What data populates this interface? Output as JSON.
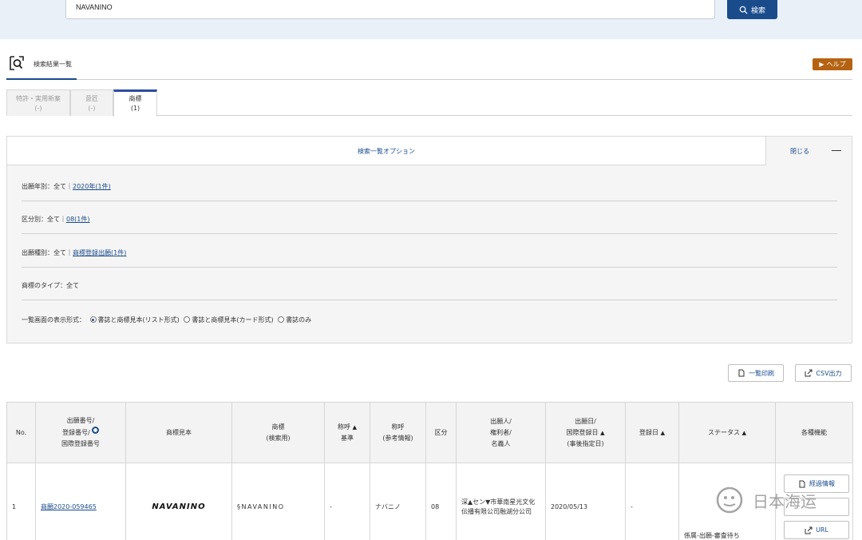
{
  "search": {
    "value": "NAVANINO",
    "button_label": "検索"
  },
  "results_header": {
    "title": "検索結果一覧",
    "help_label": "ヘルプ"
  },
  "tabs": [
    {
      "label": "特許・実用新案",
      "count": "(-)"
    },
    {
      "label": "意匠",
      "count": "(-)"
    },
    {
      "label": "商標",
      "count": "(1)"
    }
  ],
  "options": {
    "title": "検索一覧オプション",
    "close_label": "閉じる",
    "rows": [
      {
        "label": "出願年別：全て｜",
        "link": "2020年(1件)"
      },
      {
        "label": "区分別：全て｜",
        "link": "08(1件)"
      },
      {
        "label": "出願種別：全て｜",
        "link": "商標登録出願(1件)"
      },
      {
        "label": "商標のタイプ：全て",
        "link": ""
      }
    ],
    "display_format": {
      "label": "一覧画面の表示形式：",
      "choices": [
        "書誌と商標見本(リスト形式)",
        "書誌と商標見本(カード形式)",
        "書誌のみ"
      ],
      "selected": "書誌と商標見本(リスト形式)"
    }
  },
  "actions": {
    "print_label": "一覧印刷",
    "csv_label": "CSV出力"
  },
  "table": {
    "headers": {
      "no": "No.",
      "number_l1": "出願番号/",
      "number_l2": "登録番号/",
      "number_l3": "国際登録番号",
      "sample": "商標見本",
      "mark_l1": "商標",
      "mark_l2": "(検索用)",
      "yobi_l1": "称呼",
      "yobi_l2": "基準",
      "yobi_ref_l1": "称呼",
      "yobi_ref_l2": "(参考情報)",
      "class": "区分",
      "applicant_l1": "出願人/",
      "applicant_l2": "権利者/",
      "applicant_l3": "名義人",
      "date_l1": "出願日/",
      "date_l2": "国際登録日",
      "date_l3": "(事後指定日)",
      "reg_date": "登録日",
      "status": "ステータス",
      "functions": "各種機能"
    },
    "rows": [
      {
        "no": "1",
        "number": "商願2020-059465",
        "sample": "NAVANINO",
        "mark": "§NAVANINO",
        "yobi": "-",
        "yobi_ref": "ナバニノ",
        "class": "08",
        "applicant": "深▲セン▼市華南星光文化伝播有限公司融湖分公司",
        "app_date": "2020/05/13",
        "reg_date": "-",
        "status": "係属-出願-審査待ち",
        "buttons": [
          "経過情報",
          "",
          "URL"
        ]
      }
    ]
  },
  "watermark": {
    "text": "日本海运"
  }
}
